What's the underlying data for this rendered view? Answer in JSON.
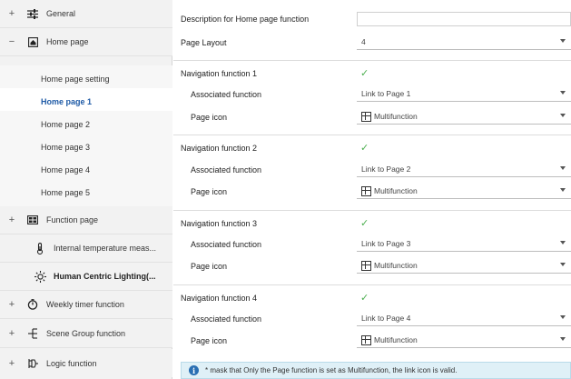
{
  "sidebar": {
    "items": [
      {
        "toggle": "+",
        "icon": "sliders-icon",
        "label": "General"
      },
      {
        "toggle": "−",
        "icon": "home-icon",
        "label": "Home page"
      },
      {
        "label": "Home page setting"
      },
      {
        "label": "Home page 1"
      },
      {
        "label": "Home page 2"
      },
      {
        "label": "Home page 3"
      },
      {
        "label": "Home page 4"
      },
      {
        "label": "Home page 5"
      },
      {
        "toggle": "+",
        "icon": "grid-icon",
        "label": "Function page"
      },
      {
        "icon": "thermometer-icon",
        "label": "Internal temperature meas..."
      },
      {
        "icon": "sun-icon",
        "label": "Human Centric Lighting(..."
      },
      {
        "toggle": "+",
        "icon": "timer-icon",
        "label": "Weekly timer function"
      },
      {
        "toggle": "+",
        "icon": "scene-icon",
        "label": "Scene Group function"
      },
      {
        "toggle": "+",
        "icon": "logic-icon",
        "label": "Logic function"
      }
    ]
  },
  "main": {
    "description_label": "Description for Home page function",
    "description_value": "",
    "layout_label": "Page Layout",
    "layout_value": "4",
    "nav": [
      {
        "title": "Navigation function 1",
        "assoc_label": "Associated function",
        "assoc_value": "Link to Page 1",
        "icon_label": "Page icon",
        "icon_value": "Multifunction"
      },
      {
        "title": "Navigation function 2",
        "assoc_label": "Associated function",
        "assoc_value": "Link to Page 2",
        "icon_label": "Page icon",
        "icon_value": "Multifunction"
      },
      {
        "title": "Navigation function 3",
        "assoc_label": "Associated function",
        "assoc_value": "Link to Page 3",
        "icon_label": "Page icon",
        "icon_value": "Multifunction"
      },
      {
        "title": "Navigation function 4",
        "assoc_label": "Associated function",
        "assoc_value": "Link to Page 4",
        "icon_label": "Page icon",
        "icon_value": "Multifunction"
      }
    ],
    "check_mark": "✓",
    "note_icon": "i",
    "note": "* mask that Only the Page function is set as Multifunction, the link icon is valid."
  },
  "colors": {
    "accent": "#1e5aa6",
    "check": "#4caf50",
    "note_bg": "#dff0f7"
  }
}
